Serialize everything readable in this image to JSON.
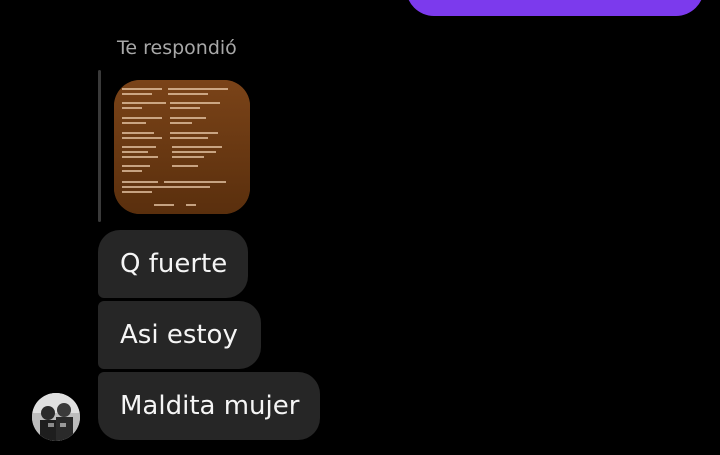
{
  "thread": {
    "reply_label": "Te respondió",
    "messages": [
      {
        "text": "Q fuerte"
      },
      {
        "text": "Asi estoy"
      },
      {
        "text": "Maldita mujer"
      }
    ]
  },
  "icons": {
    "avatar": "contact-avatar-photo",
    "reply_thumbnail": "replied-image-thumbnail"
  },
  "colors": {
    "background": "#000000",
    "sent_bubble": "#7c3aed",
    "received_bubble": "#262626",
    "reply_label": "#a8a8a8",
    "message_text": "#f5f5f5"
  }
}
